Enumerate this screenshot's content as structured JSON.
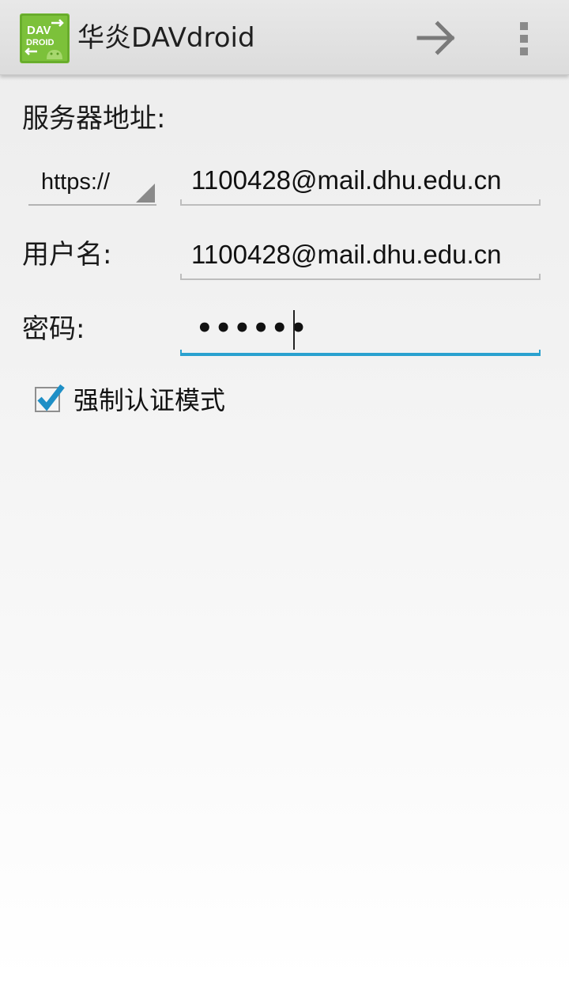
{
  "app_bar": {
    "title": "华炎DAVdroid",
    "icon_text_top": "DAV",
    "icon_text_bottom": "DROID",
    "next_icon": "arrow-right-icon",
    "overflow_icon": "more-vertical-icon"
  },
  "form": {
    "server_label": "服务器地址:",
    "scheme_selected": "https://",
    "server_value": "1100428@mail.dhu.edu.cn",
    "username_label": "用户名:",
    "username_value": "1100428@mail.dhu.edu.cn",
    "password_label": "密码:",
    "password_masked": "••••••",
    "preemptive_auth_label": "强制认证模式",
    "preemptive_auth_checked": true
  },
  "colors": {
    "accent": "#2aa1cf",
    "check": "#1e8fc6",
    "icon_green": "#6fb62f"
  }
}
